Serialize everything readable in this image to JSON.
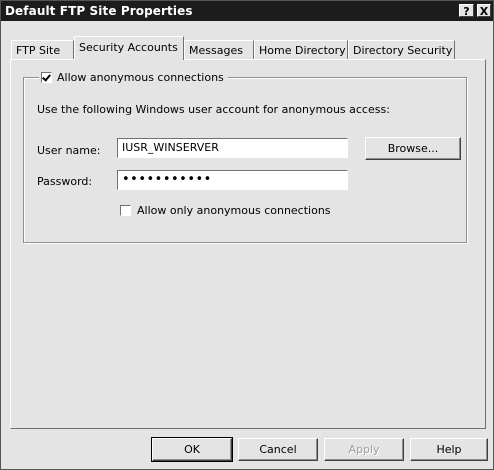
{
  "window": {
    "title": "Default FTP Site Properties",
    "help_glyph": "?",
    "close_glyph": "X"
  },
  "tabs": [
    {
      "label": "FTP Site"
    },
    {
      "label": "Security Accounts"
    },
    {
      "label": "Messages"
    },
    {
      "label": "Home Directory"
    },
    {
      "label": "Directory Security"
    }
  ],
  "anonymous": {
    "allow_label": "Allow anonymous connections",
    "allow_checked": true,
    "description": "Use the following Windows user account for anonymous access:",
    "username_label": "User name:",
    "username_value": "IUSR_WINSERVER",
    "password_label": "Password:",
    "password_value": "•••••••••••",
    "browse_label": "Browse...",
    "only_anon_label": "Allow only anonymous connections",
    "only_anon_checked": false
  },
  "footer": {
    "ok_label": "OK",
    "cancel_label": "Cancel",
    "apply_label": "Apply",
    "help_label": "Help"
  }
}
